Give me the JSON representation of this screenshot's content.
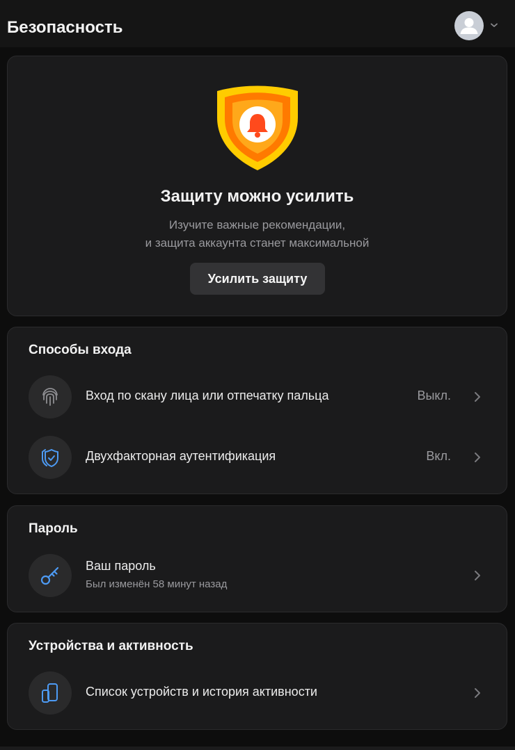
{
  "header": {
    "title": "Безопасность"
  },
  "hero": {
    "title": "Защиту можно усилить",
    "description_line1": "Изучите важные рекомендации,",
    "description_line2": "и защита аккаунта станет максимальной",
    "button_label": "Усилить защиту",
    "icon": "shield-bell-icon"
  },
  "sections": {
    "logins": {
      "title": "Способы входа",
      "items": [
        {
          "icon": "fingerprint-icon",
          "label": "Вход по скану лица или отпечатку пальца",
          "status": "Выкл."
        },
        {
          "icon": "two-factor-shield-icon",
          "label": "Двухфакторная аутентификация",
          "status": "Вкл."
        }
      ]
    },
    "password": {
      "title": "Пароль",
      "items": [
        {
          "icon": "key-icon",
          "label": "Ваш пароль",
          "sub": "Был изменён 58 минут назад"
        }
      ]
    },
    "devices": {
      "title": "Устройства и активность",
      "items": [
        {
          "icon": "devices-icon",
          "label": "Список устройств и история активности"
        }
      ]
    }
  },
  "colors": {
    "background": "#0d0d0d",
    "card": "#1b1b1c",
    "accent_blue": "#4d9bf5",
    "shield_yellow": "#ffcc00",
    "shield_orange": "#ff9a00",
    "bell_red": "#ff4a1c"
  }
}
